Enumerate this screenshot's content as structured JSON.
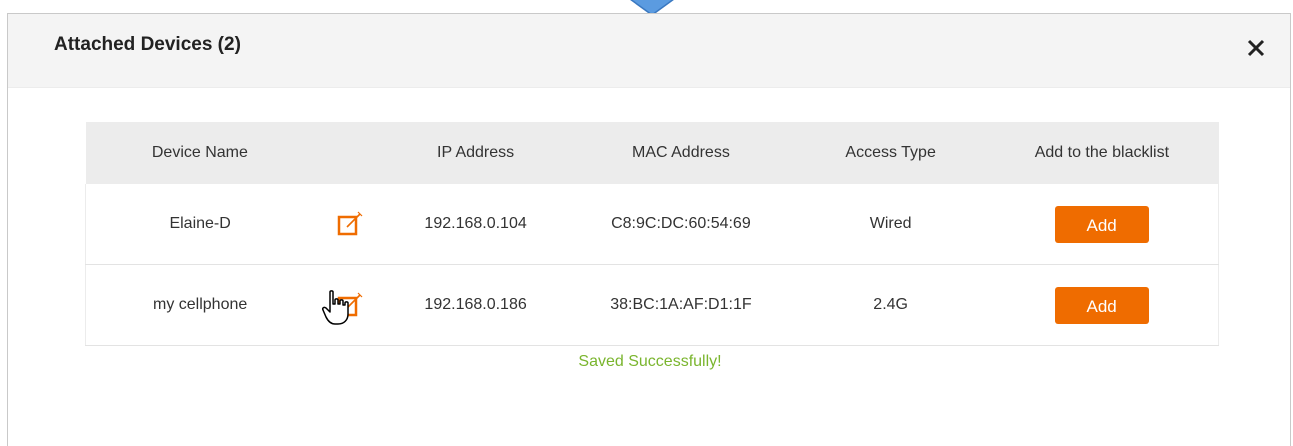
{
  "dialog": {
    "title": "Attached Devices (2)",
    "close_icon": "close-icon"
  },
  "table": {
    "headers": [
      "Device Name",
      "IP Address",
      "MAC Address",
      "Access Type",
      "Add to the blacklist"
    ],
    "rows": [
      {
        "device_name": "Elaine-D",
        "ip": "192.168.0.104",
        "mac": "C8:9C:DC:60:54:69",
        "access_type": "Wired",
        "action_label": "Add"
      },
      {
        "device_name": "my cellphone",
        "ip": "192.168.0.186",
        "mac": "38:BC:1A:AF:D1:1F",
        "access_type": "2.4G",
        "action_label": "Add"
      }
    ]
  },
  "status": {
    "message": "Saved Successfully!"
  },
  "colors": {
    "accent_orange": "#ef6c00",
    "success_green": "#7ab52e",
    "arrow_blue": "#4a90d9"
  }
}
